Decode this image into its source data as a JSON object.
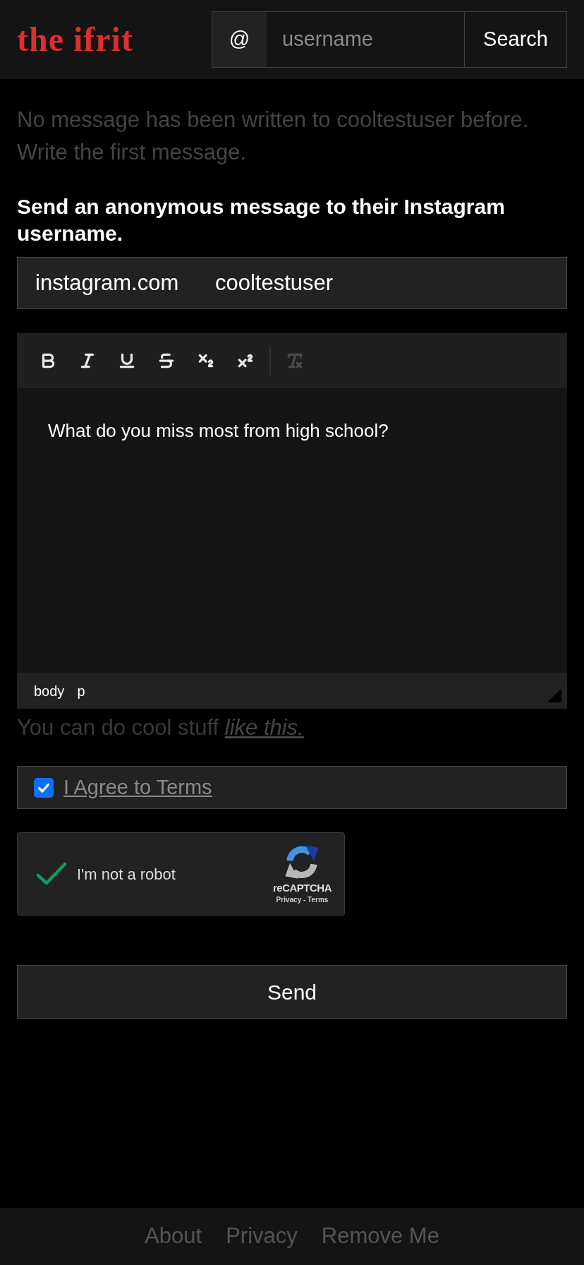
{
  "header": {
    "logo": "the ifrit",
    "search": {
      "prefix": "@",
      "placeholder": "username",
      "button": "Search"
    }
  },
  "notice": {
    "lines": [
      "No message has been written to cooltestuser before.",
      "Write the first message."
    ]
  },
  "heading": "Send an anonymous message to their Instagram username.",
  "recipient": {
    "prefix": "instagram.com",
    "value": "cooltestuser"
  },
  "editor": {
    "toolbar": [
      [
        {
          "kind": "bold",
          "disabled": false
        },
        {
          "kind": "italic",
          "disabled": false
        },
        {
          "kind": "underline",
          "disabled": false
        },
        {
          "kind": "strikethrough",
          "disabled": false
        },
        {
          "kind": "subscript",
          "disabled": false
        },
        {
          "kind": "superscript",
          "disabled": false
        }
      ],
      [
        {
          "kind": "clear_formatting",
          "disabled": true
        }
      ]
    ],
    "content": "What do you miss most from high school?",
    "path": [
      "body",
      "p"
    ]
  },
  "hint": {
    "text": "You can do cool stuff",
    "link": "like this."
  },
  "terms": {
    "label": "I Agree to Terms",
    "checked": true
  },
  "captcha": {
    "label": "I'm not a robot",
    "checked": true,
    "brand": "reCAPTCHA",
    "links": "Privacy - Terms"
  },
  "send": "Send",
  "footer": [
    "About",
    "Privacy",
    "Remove Me"
  ]
}
